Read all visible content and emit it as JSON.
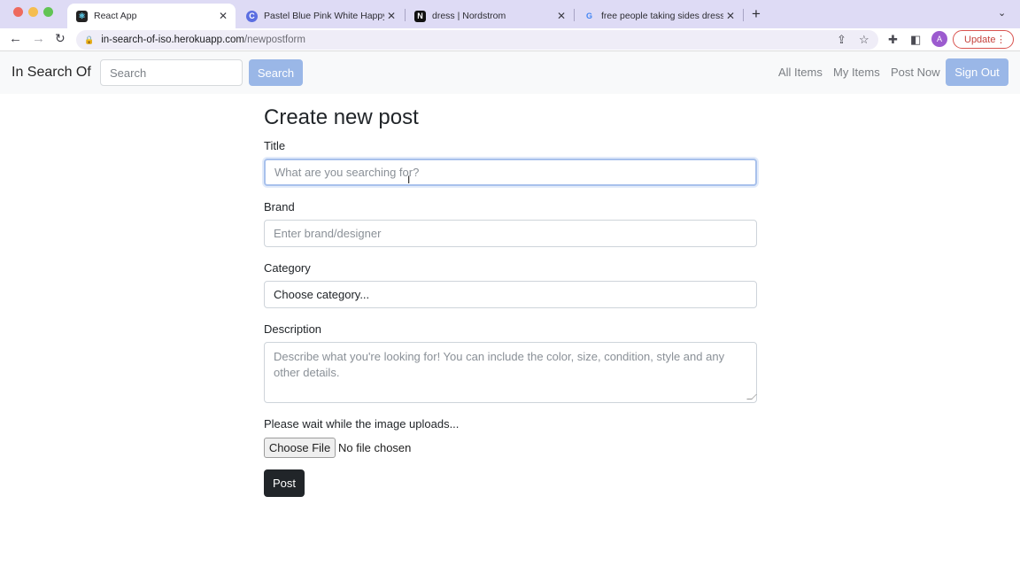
{
  "browser": {
    "tabs": [
      {
        "title": "React App",
        "active": true
      },
      {
        "title": "Pastel Blue Pink White Happy Bir",
        "active": false
      },
      {
        "title": "dress | Nordstrom",
        "active": false
      },
      {
        "title": "free people taking sides dress",
        "active": false
      }
    ],
    "url_host": "in-search-of-iso.herokuapp.com",
    "url_path": "/newpostform",
    "avatar_letter": "A",
    "update_label": "Update"
  },
  "navbar": {
    "brand": "In Search Of",
    "search_placeholder": "Search",
    "search_button": "Search",
    "links": [
      "All Items",
      "My Items",
      "Post Now"
    ],
    "signout_button": "Sign Out"
  },
  "form": {
    "heading": "Create new post",
    "title_label": "Title",
    "title_placeholder": "What are you searching for?",
    "brand_label": "Brand",
    "brand_placeholder": "Enter brand/designer",
    "category_label": "Category",
    "category_selected": "Choose category...",
    "description_label": "Description",
    "description_placeholder": "Describe what you're looking for! You can include the color, size, condition, style and any other details.",
    "upload_status": "Please wait while the image uploads...",
    "file_button": "Choose File",
    "file_status": "No file chosen",
    "submit_button": "Post"
  },
  "colors": {
    "tabbar": "#dedbf5",
    "navbar": "#f8f9fa",
    "primary_disabled": "#9ab7e7",
    "post_button": "#212529"
  }
}
